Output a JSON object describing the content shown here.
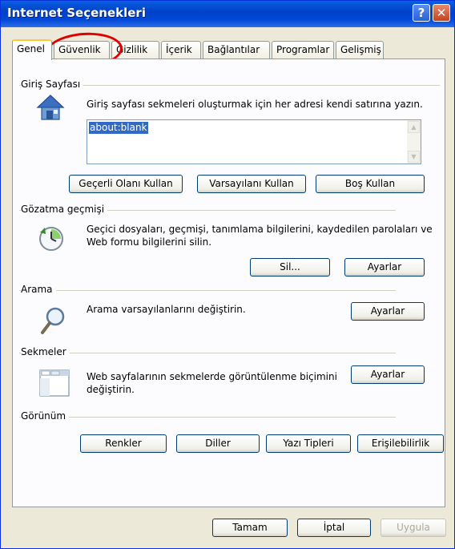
{
  "window": {
    "title": "Internet Seçenekleri",
    "help_glyph": "?",
    "close_glyph": "✕"
  },
  "tabs": [
    "Genel",
    "Güvenlik",
    "Gizlilik",
    "İçerik",
    "Bağlantılar",
    "Programlar",
    "Gelişmiş"
  ],
  "home": {
    "label": "Giriş Sayfası",
    "description": "Giriş sayfası sekmeleri oluşturmak için her adresi kendi satırına yazın.",
    "value": "about:blank",
    "buttons": {
      "current": "Geçerli Olanı Kullan",
      "default": "Varsayılanı Kullan",
      "blank": "Boş Kullan"
    }
  },
  "history": {
    "label": "Gözatma geçmişi",
    "description_line1": "Geçici dosyaları, geçmişi, tanımlama bilgilerini, kaydedilen parolaları ve",
    "description_line2": "Web formu bilgilerini silin.",
    "delete_button": "Sil...",
    "settings_button": "Ayarlar"
  },
  "search": {
    "label": "Arama",
    "description": "Arama varsayılanlarını değiştirin.",
    "settings_button": "Ayarlar"
  },
  "tabs_group": {
    "label": "Sekmeler",
    "description_line1": "Web sayfalarının sekmelerde görüntülenme biçimini",
    "description_line2": "değiştirin.",
    "settings_button": "Ayarlar"
  },
  "appearance": {
    "label": "Görünüm",
    "buttons": {
      "colors": "Renkler",
      "languages": "Diller",
      "fonts": "Yazı Tipleri",
      "accessibility": "Erişilebilirlik"
    }
  },
  "footer": {
    "ok": "Tamam",
    "cancel": "İptal",
    "apply": "Uygula"
  },
  "colors": {
    "titlebar": "#0054e3",
    "dialog": "#ece9d8",
    "selection": "#316ac5",
    "annotation": "#e00000"
  }
}
